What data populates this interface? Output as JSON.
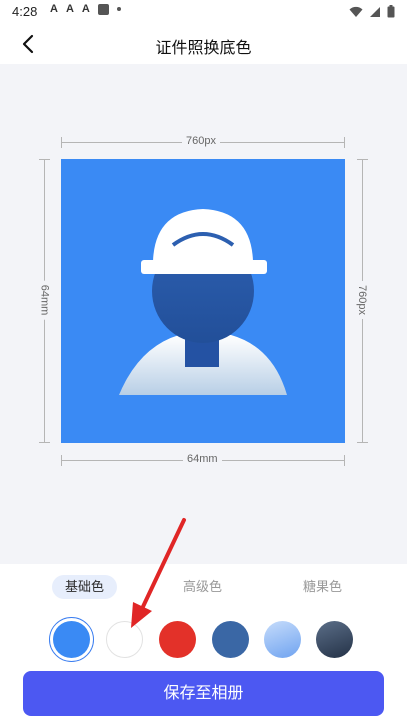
{
  "status_bar": {
    "time": "4:28",
    "app_icons": [
      "A",
      "A",
      "A"
    ]
  },
  "header": {
    "title": "证件照换底色"
  },
  "preview": {
    "width_label_top": "760px",
    "height_label_left": "64mm",
    "height_label_right": "760px",
    "width_label_bottom": "64mm",
    "background_color": "#3a8af4"
  },
  "tabs": [
    {
      "label": "基础色"
    },
    {
      "label": "高级色"
    },
    {
      "label": "糖果色"
    }
  ],
  "swatches": [
    {
      "name": "blue",
      "color": "#3a8af4"
    },
    {
      "name": "white",
      "color": "#ffffff"
    },
    {
      "name": "red",
      "color": "#e33129"
    },
    {
      "name": "dark-blue",
      "color": "#3a67a5"
    },
    {
      "name": "light-blue-gradient",
      "color": "#8fb9f5"
    },
    {
      "name": "dark-gray-gradient",
      "color": "#3b4b60"
    }
  ],
  "selected_swatch": "blue",
  "save_button": {
    "label": "保存至相册"
  }
}
